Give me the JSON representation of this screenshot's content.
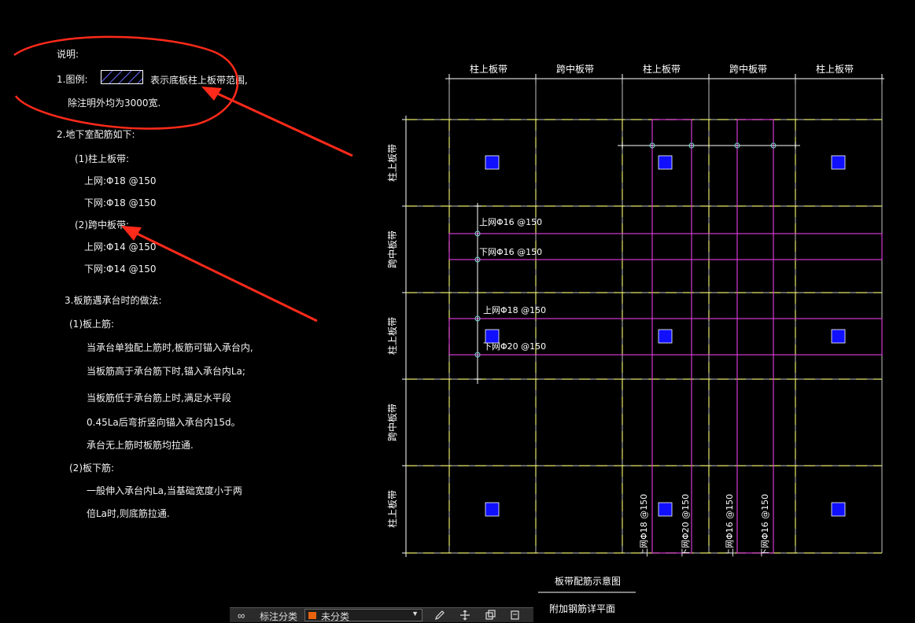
{
  "notes": {
    "heading": "说明:",
    "legend_prefix": "1.图例:",
    "legend_desc": "表示底板柱上板带范围,",
    "legend_note": "除注明外均为3000宽.",
    "section2": "2.地下室配筋如下:",
    "column_strip": "(1)柱上板带:",
    "column_top": "上网:Φ18 @150",
    "column_bottom": "下网:Φ18 @150",
    "middle_strip": "(2)跨中板带:",
    "middle_top": "上网:Φ14 @150",
    "middle_bottom": "下网:Φ14 @150",
    "section3": "3.板筋遇承台时的做法:",
    "top_bars": "(1)板上筋:",
    "top_line1": "当承台单独配上筋时,板筋可锚入承台内,",
    "top_line2": "当板筋高于承台筋下时,锚入承台内La;",
    "top_line3": "当板筋低于承台筋上时,满足水平段",
    "top_line4": "0.45La后弯折竖向锚入承台内15d。",
    "top_line5": "承台无上筋时板筋均拉通.",
    "bottom_bars": "(2)板下筋:",
    "bottom_line1": "一般伸入承台内La,当基础宽度小于两",
    "bottom_line2": "倍La时,则底筋拉通."
  },
  "plan": {
    "top_strips": [
      "柱上板带",
      "跨中板带",
      "柱上板带",
      "跨中板带",
      "柱上板带"
    ],
    "side_strips": [
      "柱上板带",
      "跨中板带",
      "柱上板带",
      "跨中板带",
      "柱上板带"
    ],
    "horizontal_rebar": [
      "上网Φ16 @150",
      "下网Φ16 @150",
      "上网Φ18 @150",
      "下网Φ20 @150"
    ],
    "vertical_rebar": [
      "上网Φ18 @150",
      "下网Φ20 @150",
      "上网Φ16 @150",
      "下网Φ16 @150"
    ],
    "caption_title": "板带配筋示意图",
    "caption_subtitle": "附加钢筋详平面"
  },
  "toolbar": {
    "link_label": "∞",
    "category_label": "标注分类",
    "dropdown_value": "未分类",
    "icon_names": [
      "edit-icon",
      "move-icon",
      "copy-icon",
      "layer-icon"
    ]
  },
  "colors": {
    "grid_white": "#ffffff",
    "dash_yellow": "#e8e86a",
    "rebar_magenta": "#d23ad2",
    "column_blue": "#1010ff",
    "annotation_red": "#ff2a1a",
    "legend_hatch": "#6a6aff",
    "node_cyan": "#7ad6d6"
  }
}
